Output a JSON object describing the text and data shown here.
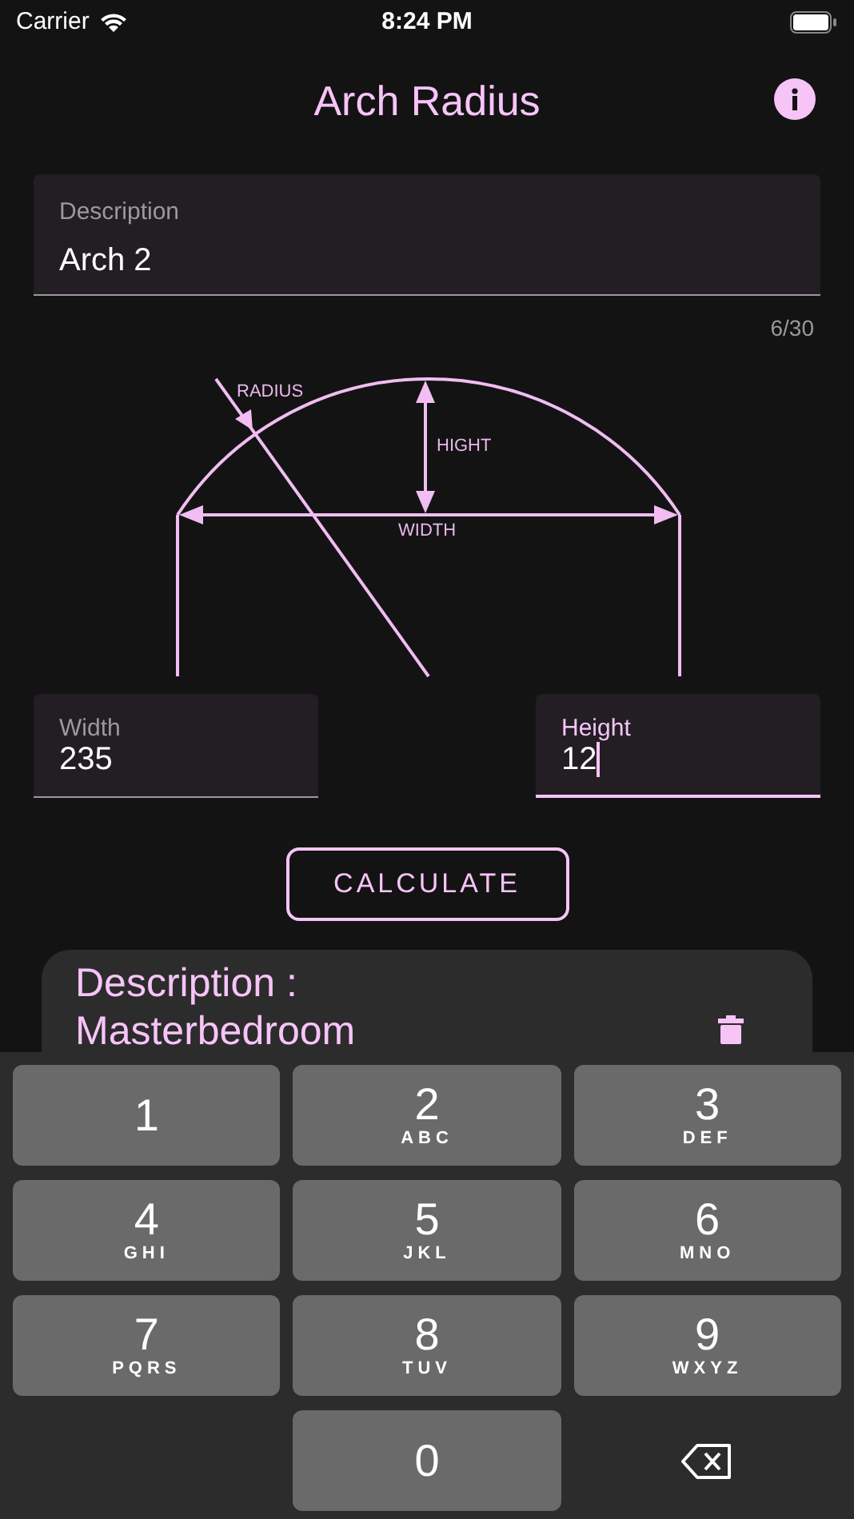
{
  "status_bar": {
    "carrier": "Carrier",
    "time": "8:24 PM"
  },
  "title": "Arch Radius",
  "description_field": {
    "label": "Description",
    "value": "Arch 2",
    "counter": "6/30"
  },
  "diagram": {
    "labels": [
      "RADIUS",
      "HIGHT",
      "WIDTH"
    ]
  },
  "fields": [
    {
      "label": "Width",
      "value": "235",
      "focused": false
    },
    {
      "label": "Height",
      "value": "12",
      "focused": true
    }
  ],
  "calculate_button": "CALCULATE",
  "result_card": {
    "lines": [
      "Description :",
      "Masterbedroom"
    ]
  },
  "keyboard": [
    {
      "kind": "digit",
      "digit": "1"
    },
    {
      "kind": "digit",
      "digit": "2",
      "letters": "ABC"
    },
    {
      "kind": "digit",
      "digit": "3",
      "letters": "DEF"
    },
    {
      "kind": "digit",
      "digit": "4",
      "letters": "GHI"
    },
    {
      "kind": "digit",
      "digit": "5",
      "letters": "JKL"
    },
    {
      "kind": "digit",
      "digit": "6",
      "letters": "MNO"
    },
    {
      "kind": "digit",
      "digit": "7",
      "letters": "PQRS"
    },
    {
      "kind": "digit",
      "digit": "8",
      "letters": "TUV"
    },
    {
      "kind": "digit",
      "digit": "9",
      "letters": "WXYZ"
    },
    {
      "kind": "blank"
    },
    {
      "kind": "digit",
      "digit": "0"
    },
    {
      "kind": "backspace"
    }
  ]
}
